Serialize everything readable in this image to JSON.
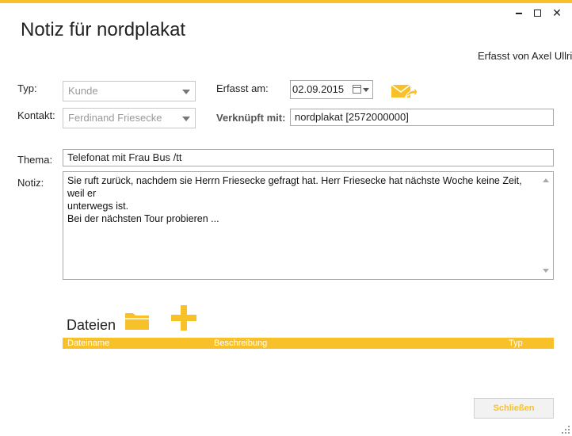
{
  "window": {
    "title": "Notiz für nordplakat",
    "minimize": "▬",
    "maximize": "☐",
    "close": "✕"
  },
  "header": {
    "erfasst_von": "Erfasst von Axel Ullric"
  },
  "form": {
    "typ_label": "Typ:",
    "typ_value": "Kunde",
    "kontakt_label": "Kontakt:",
    "kontakt_value": "Ferdinand Friesecke",
    "erfasst_am_label": "Erfasst am:",
    "erfasst_am_value": "02.09.2015",
    "verknuepft_label": "Verknüpft mit:",
    "verknuepft_value": "nordplakat [2572000000]",
    "thema_label": "Thema:",
    "thema_value": "Telefonat mit Frau Bus /tt",
    "notiz_label": "Notiz:",
    "notiz_lines": [
      "Sie ruft zurück, nachdem sie Herrn Friesecke gefragt hat. Herr Friesecke hat nächste Woche keine Zeit, weil er",
      "unterwegs ist.",
      "Bei der nächsten Tour probieren ..."
    ]
  },
  "files": {
    "title": "Dateien",
    "columns": [
      "Dateiname",
      "Beschreibung",
      "Typ"
    ]
  },
  "footer": {
    "close_label": "Schließen"
  },
  "colors": {
    "accent": "#f8c12a"
  },
  "icons": [
    "folder-icon",
    "add-icon",
    "email-forward-icon",
    "calendar-icon",
    "resize-grip-icon"
  ]
}
